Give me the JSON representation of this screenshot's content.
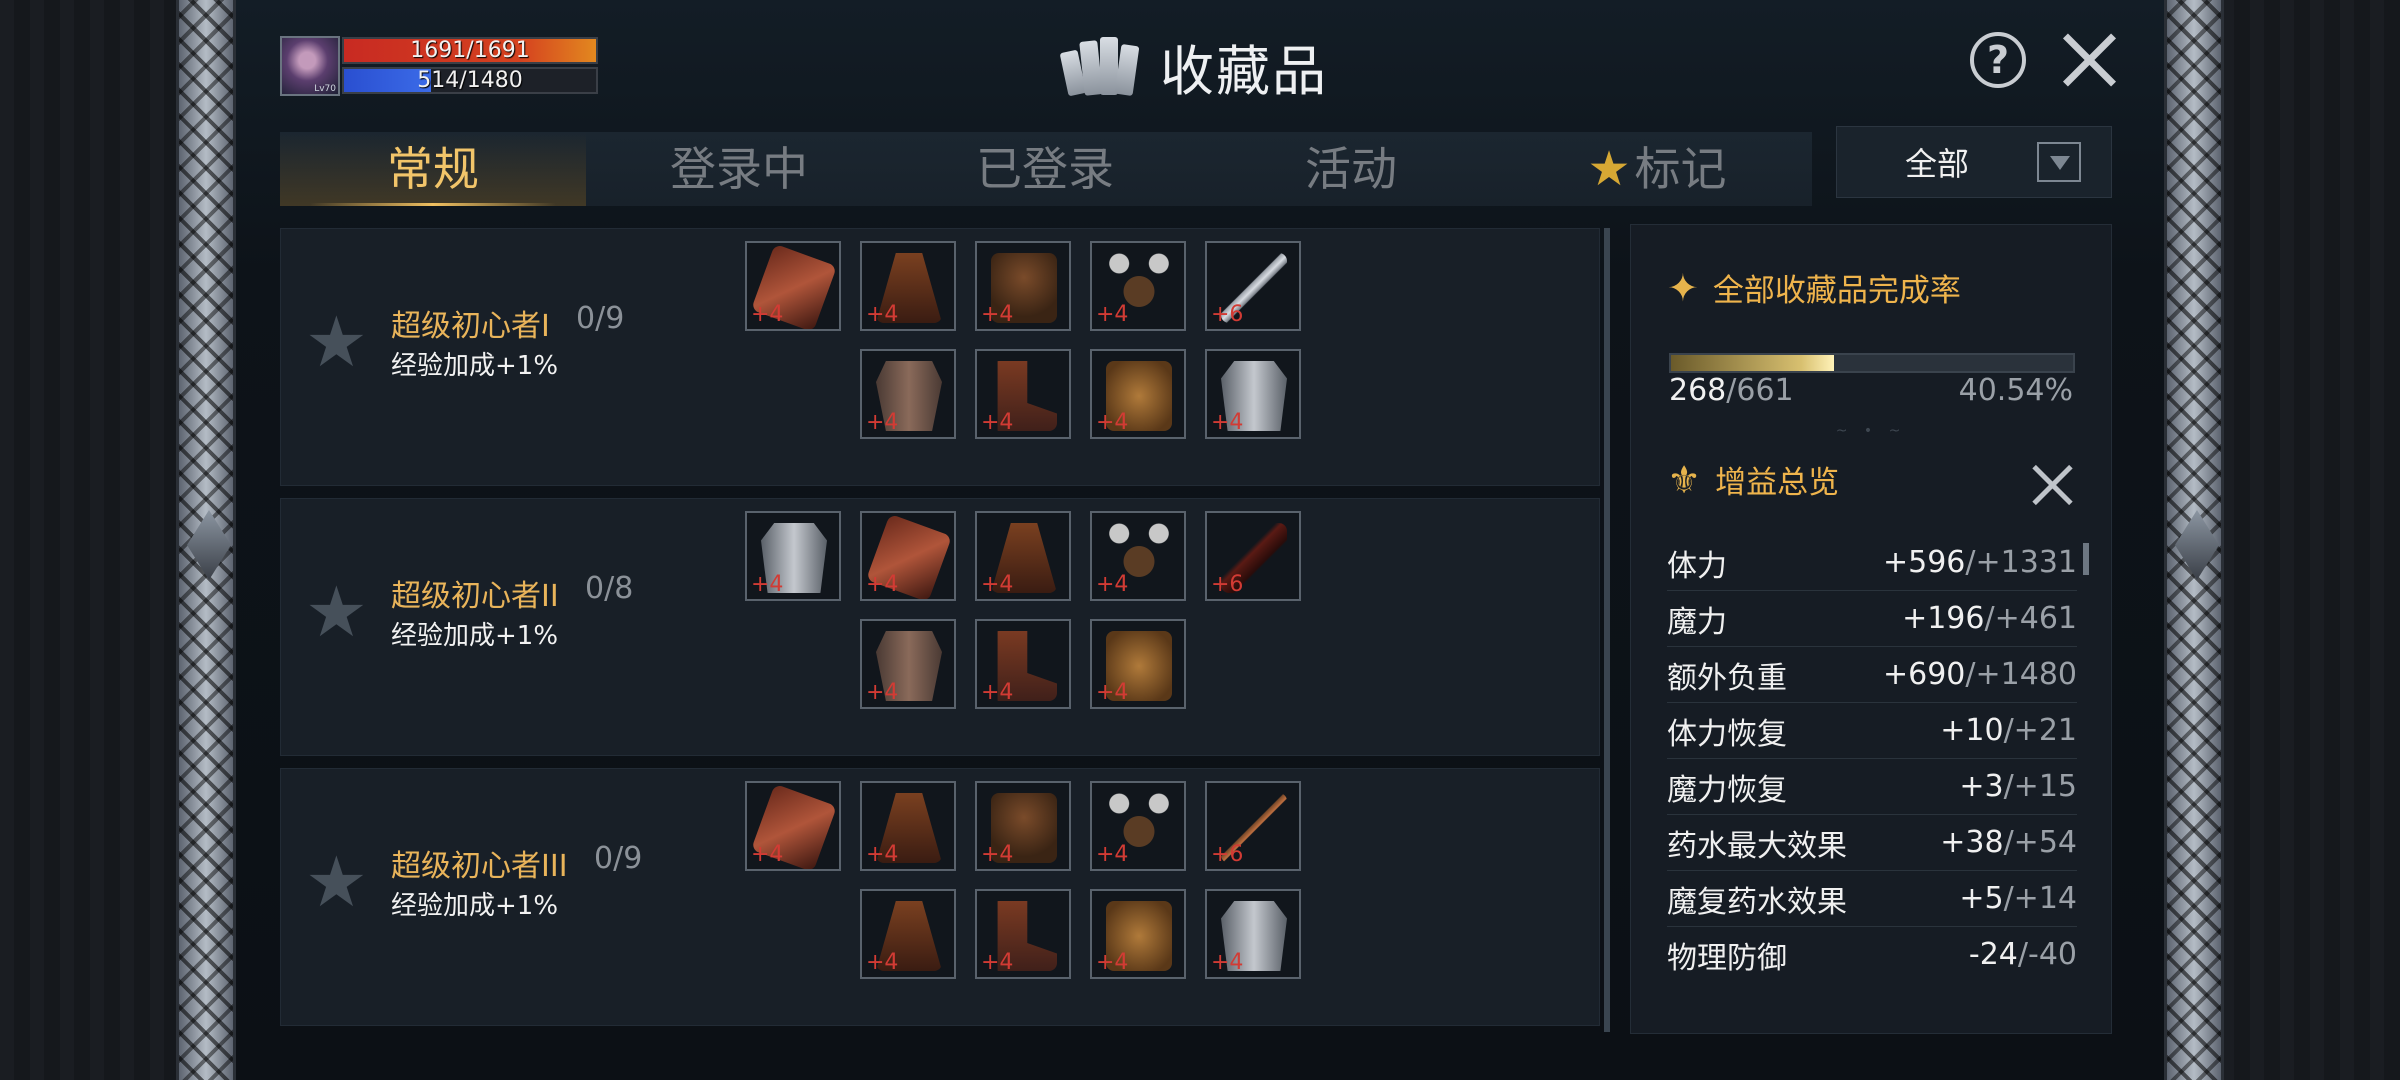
{
  "player": {
    "level_label": "Lv70",
    "hp_text": "1691/1691",
    "mp_text": "514/1480"
  },
  "title": "收藏品",
  "tabs": [
    {
      "label": "常规"
    },
    {
      "label": "登录中"
    },
    {
      "label": "已登录"
    },
    {
      "label": "活动"
    },
    {
      "label": "标记"
    }
  ],
  "filter": {
    "value": "全部"
  },
  "collections": [
    {
      "name": "超级初心者I",
      "progress": "0/9",
      "bonus": "经验加成+1%",
      "items": [
        {
          "type": "glove",
          "plus": "+4"
        },
        {
          "type": "cape",
          "plus": "+4"
        },
        {
          "type": "helm",
          "plus": "+4"
        },
        {
          "type": "horn",
          "plus": "+4"
        },
        {
          "type": "sword",
          "plus": "+6"
        },
        {
          "type": "armor",
          "plus": "+4"
        },
        {
          "type": "boots",
          "plus": "+4"
        },
        {
          "type": "belt",
          "plus": "+4"
        },
        {
          "type": "jacket",
          "plus": "+4"
        }
      ]
    },
    {
      "name": "超级初心者II",
      "progress": "0/8",
      "bonus": "经验加成+1%",
      "items": [
        {
          "type": "jacket",
          "plus": "+4"
        },
        {
          "type": "glove",
          "plus": "+4"
        },
        {
          "type": "cape",
          "plus": "+4"
        },
        {
          "type": "horn",
          "plus": "+4"
        },
        {
          "type": "feather",
          "plus": "+6"
        },
        {
          "type": "armor",
          "plus": "+4"
        },
        {
          "type": "boots",
          "plus": "+4"
        },
        {
          "type": "belt",
          "plus": "+4"
        }
      ]
    },
    {
      "name": "超级初心者III",
      "progress": "0/9",
      "bonus": "经验加成+1%",
      "items": [
        {
          "type": "glove",
          "plus": "+4"
        },
        {
          "type": "cape",
          "plus": "+4"
        },
        {
          "type": "helm",
          "plus": "+4"
        },
        {
          "type": "horn",
          "plus": "+4"
        },
        {
          "type": "staff",
          "plus": "+6"
        },
        {
          "type": "cape",
          "plus": "+4"
        },
        {
          "type": "boots",
          "plus": "+4"
        },
        {
          "type": "belt",
          "plus": "+4"
        },
        {
          "type": "jacket",
          "plus": "+4"
        }
      ]
    }
  ],
  "completion": {
    "title": "全部收藏品完成率",
    "current": "268",
    "total": "/661",
    "percent": "40.54%",
    "fraction": 0.4054
  },
  "buffs": {
    "title": "增益总览",
    "stats": [
      {
        "label": "体力",
        "current": "+596",
        "max": "/+1331"
      },
      {
        "label": "魔力",
        "current": "+196",
        "max": "/+461"
      },
      {
        "label": "额外负重",
        "current": "+690",
        "max": "/+1480"
      },
      {
        "label": "体力恢复",
        "current": "+10",
        "max": "/+21"
      },
      {
        "label": "魔力恢复",
        "current": "+3",
        "max": "/+15"
      },
      {
        "label": "药水最大效果",
        "current": "+38",
        "max": "/+54"
      },
      {
        "label": "魔复药水效果",
        "current": "+5",
        "max": "/+14"
      },
      {
        "label": "物理防御",
        "current": "-24",
        "max": "/-40"
      }
    ]
  },
  "colors": {
    "accent_gold": "#efb44c",
    "tab_active": "#f2c56a",
    "plus_red": "#d23b34",
    "hp_red": "#c82a22",
    "mp_blue": "#2a4fd0"
  }
}
